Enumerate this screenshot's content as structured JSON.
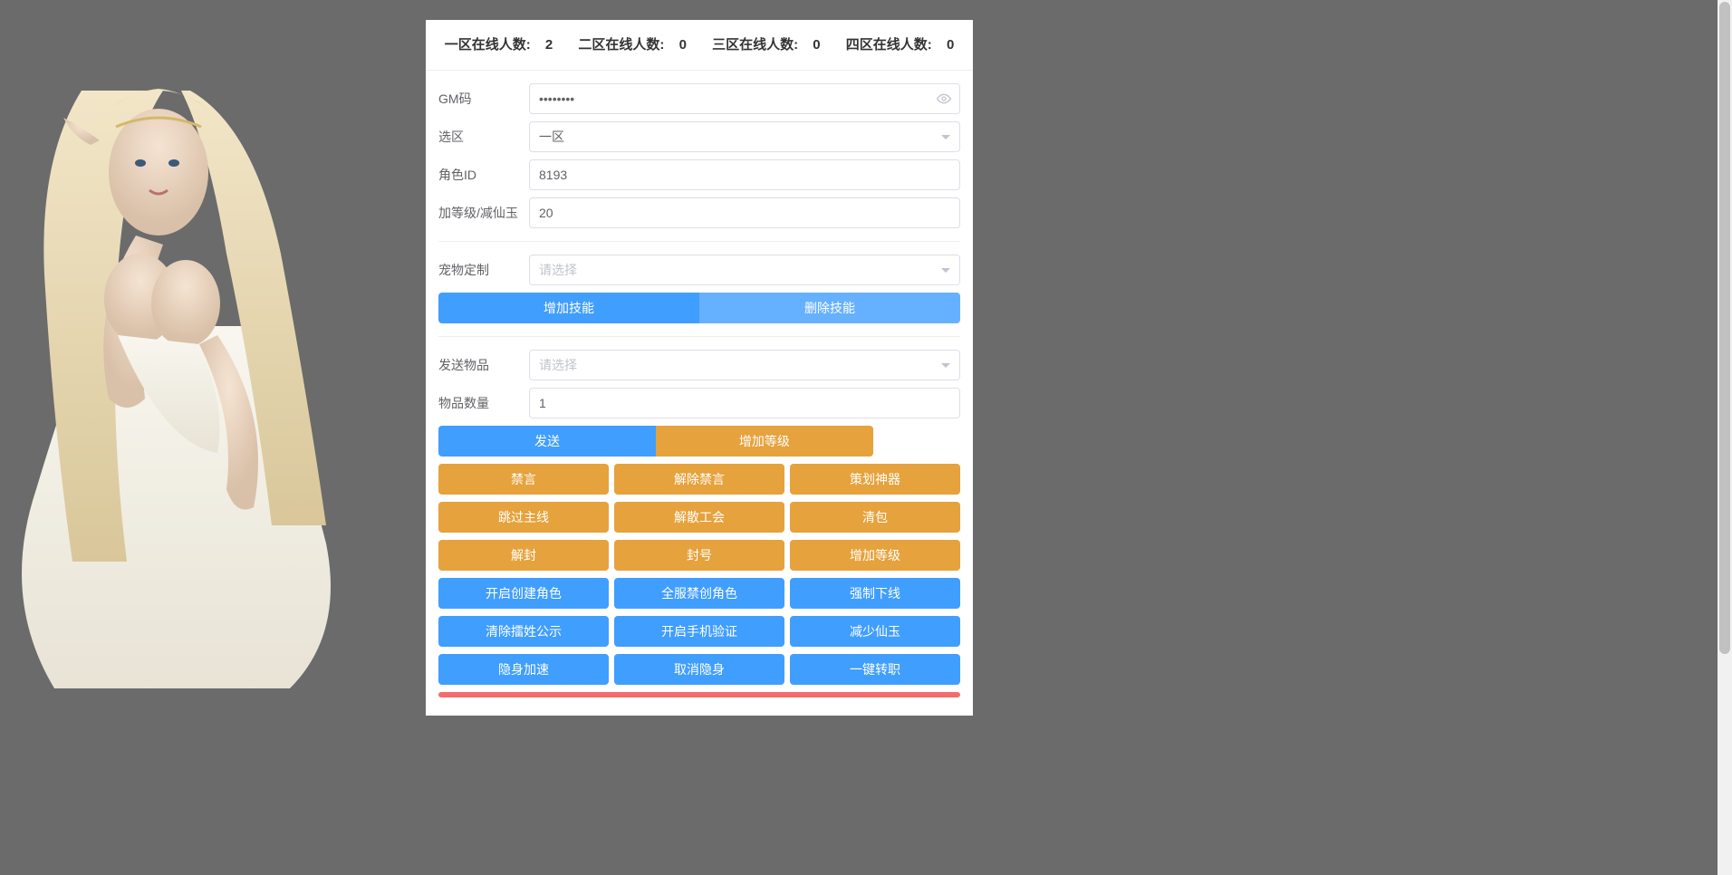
{
  "header": {
    "zone1": {
      "label": "一区在线人数:",
      "value": "2"
    },
    "zone2": {
      "label": "二区在线人数:",
      "value": "0"
    },
    "zone3": {
      "label": "三区在线人数:",
      "value": "0"
    },
    "zone4": {
      "label": "四区在线人数:",
      "value": "0"
    }
  },
  "form": {
    "gm_code": {
      "label": "GM码",
      "value": "••••••••"
    },
    "zone_select": {
      "label": "选区",
      "value": "一区"
    },
    "role_id": {
      "label": "角色ID",
      "value": "8193"
    },
    "level_jade": {
      "label": "加等级/减仙玉",
      "value": "20"
    },
    "pet_custom": {
      "label": "宠物定制",
      "placeholder": "请选择"
    },
    "add_skill": "增加技能",
    "del_skill": "删除技能",
    "send_item": {
      "label": "发送物品",
      "placeholder": "请选择"
    },
    "item_count": {
      "label": "物品数量",
      "value": "1"
    }
  },
  "buttons": {
    "row1": [
      "发送",
      "增加等级"
    ],
    "row2": [
      "禁言",
      "解除禁言",
      "策划神器"
    ],
    "row3": [
      "跳过主线",
      "解散工会",
      "清包"
    ],
    "row4": [
      "解封",
      "封号",
      "增加等级"
    ],
    "row5": [
      "开启创建角色",
      "全服禁创角色",
      "强制下线"
    ],
    "row6": [
      "清除擂姓公示",
      "开启手机验证",
      "减少仙玉"
    ],
    "row7": [
      "隐身加速",
      "取消隐身",
      "一键转职"
    ]
  }
}
